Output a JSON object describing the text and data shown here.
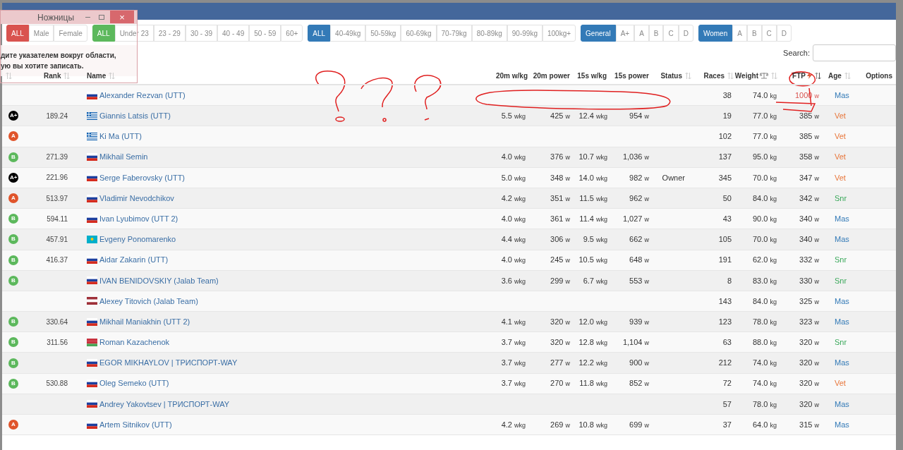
{
  "snip_window": {
    "title": "Ножницы",
    "close": "×",
    "message": [
      "дите указателем вокруг области,",
      "ую вы хотите записать."
    ]
  },
  "filter_groups": [
    {
      "color": "#d9534f",
      "options": [
        {
          "label": "ALL",
          "selected": true
        },
        {
          "label": "Male",
          "selected": false
        },
        {
          "label": "Female",
          "selected": false
        }
      ]
    },
    {
      "color": "#5cb85c",
      "options": [
        {
          "label": "ALL",
          "selected": true
        },
        {
          "label": "Under 23",
          "selected": false
        },
        {
          "label": "23 - 29",
          "selected": false
        },
        {
          "label": "30 - 39",
          "selected": false
        },
        {
          "label": "40 - 49",
          "selected": false
        },
        {
          "label": "50 - 59",
          "selected": false
        },
        {
          "label": "60+",
          "selected": false
        }
      ]
    },
    {
      "color": "#337ab7",
      "options": [
        {
          "label": "ALL",
          "selected": true
        },
        {
          "label": "40-49kg",
          "selected": false
        },
        {
          "label": "50-59kg",
          "selected": false
        },
        {
          "label": "60-69kg",
          "selected": false
        },
        {
          "label": "70-79kg",
          "selected": false
        },
        {
          "label": "80-89kg",
          "selected": false
        },
        {
          "label": "90-99kg",
          "selected": false
        },
        {
          "label": "100kg+",
          "selected": false
        }
      ]
    },
    {
      "color": "#337ab7",
      "options": [
        {
          "label": "General",
          "selected": true
        },
        {
          "label": "A+",
          "selected": false
        },
        {
          "label": "A",
          "selected": false
        },
        {
          "label": "B",
          "selected": false
        },
        {
          "label": "C",
          "selected": false
        },
        {
          "label": "D",
          "selected": false
        }
      ]
    },
    {
      "color": "#337ab7",
      "options": [
        {
          "label": "Women",
          "selected": true
        },
        {
          "label": "A",
          "selected": false
        },
        {
          "label": "B",
          "selected": false
        },
        {
          "label": "C",
          "selected": false
        },
        {
          "label": "D",
          "selected": false
        }
      ]
    }
  ],
  "search": {
    "label": "Search:"
  },
  "table": {
    "columns": [
      {
        "sortable": true,
        "sorted": false
      },
      {
        "label": "Rank",
        "sortable": true,
        "sorted": false
      },
      {
        "label": "Name",
        "sortable": true,
        "sorted": false
      },
      {
        "label": "20m w/kg",
        "sortable": false,
        "sorted": false
      },
      {
        "label": "20m power",
        "sortable": false,
        "sorted": false
      },
      {
        "label": "15s w/kg",
        "sortable": false,
        "sorted": false
      },
      {
        "label": "15s power",
        "sortable": false,
        "sorted": false
      },
      {
        "label": "Status",
        "sortable": true,
        "sorted": false
      },
      {
        "label": "Races",
        "sortable": true,
        "sorted": false
      },
      {
        "label": "Weight",
        "sortable": true,
        "sorted": false
      },
      {
        "label": "FTP",
        "sortable": true,
        "sorted": true
      },
      {
        "label": "Age",
        "sortable": true,
        "sorted": false
      },
      {
        "label": "Options",
        "sortable": false,
        "sorted": false
      }
    ],
    "rows": [
      {
        "rank": "",
        "kind": "ru",
        "name": "Alexander Rezvan (UTT)",
        "w20": "",
        "p20": "",
        "w15": "",
        "p15": "",
        "status": "",
        "races": "38",
        "weight": "74.0 kg",
        "ftp": "1000 w",
        "ftp_highlighted": true,
        "age": {
          "label": "Mas",
          "color": "#337ab7"
        }
      },
      {
        "badge": {
          "label": "A+",
          "color": "#000000"
        },
        "rank": "189.24",
        "kind": "gr",
        "name": "Giannis Latsis (UTT)",
        "w20": "5.5 wkg",
        "p20": "425 w",
        "w15": "12.4 wkg",
        "p15": "954 w",
        "status": "",
        "races": "19",
        "weight": "77.0 kg",
        "ftp": "385 w",
        "ftp_highlighted": false,
        "age": {
          "label": "Vet",
          "color": "#e8763a"
        }
      },
      {
        "badge": {
          "label": "A",
          "color": "#e0542b"
        },
        "rank": "",
        "kind": "gr",
        "name": "Ki Ma (UTT)",
        "w20": "",
        "p20": "",
        "w15": "",
        "p15": "",
        "status": "",
        "races": "102",
        "weight": "77.0 kg",
        "ftp": "385 w",
        "ftp_highlighted": false,
        "age": {
          "label": "Vet",
          "color": "#e8763a"
        }
      },
      {
        "badge": {
          "label": "B",
          "color": "#5cb85c"
        },
        "rank": "271.39",
        "kind": "ru",
        "name": "Mikhail Semin",
        "w20": "4.0 wkg",
        "p20": "376 w",
        "w15": "10.7 wkg",
        "p15": "1,036 w",
        "status": "",
        "races": "137",
        "weight": "95.0 kg",
        "ftp": "358 w",
        "ftp_highlighted": false,
        "age": {
          "label": "Vet",
          "color": "#e8763a"
        }
      },
      {
        "badge": {
          "label": "A+",
          "color": "#000000"
        },
        "rank": "221.96",
        "kind": "ru",
        "name": "Serge Faberovsky (UTT)",
        "w20": "5.0 wkg",
        "p20": "348 w",
        "w15": "14.0 wkg",
        "p15": "982 w",
        "status": "Owner",
        "races": "345",
        "weight": "70.0 kg",
        "ftp": "347 w",
        "ftp_highlighted": false,
        "age": {
          "label": "Vet",
          "color": "#e8763a"
        }
      },
      {
        "badge": {
          "label": "A",
          "color": "#e0542b"
        },
        "rank": "513.97",
        "kind": "ru",
        "name": "Vladimir Nevodchikov",
        "w20": "4.2 wkg",
        "p20": "351 w",
        "w15": "11.5 wkg",
        "p15": "962 w",
        "status": "",
        "races": "50",
        "weight": "84.0 kg",
        "ftp": "342 w",
        "ftp_highlighted": false,
        "age": {
          "label": "Snr",
          "color": "#3aa85a"
        }
      },
      {
        "badge": {
          "label": "B",
          "color": "#5cb85c"
        },
        "rank": "594.11",
        "kind": "ru",
        "name": "Ivan Lyubimov (UTT 2)",
        "w20": "4.0 wkg",
        "p20": "361 w",
        "w15": "11.4 wkg",
        "p15": "1,027 w",
        "status": "",
        "races": "43",
        "weight": "90.0 kg",
        "ftp": "340 w",
        "ftp_highlighted": false,
        "age": {
          "label": "Mas",
          "color": "#337ab7"
        }
      },
      {
        "badge": {
          "label": "B",
          "color": "#5cb85c"
        },
        "rank": "457.91",
        "kind": "kz",
        "name": "Evgeny Ponomarenko",
        "w20": "4.4 wkg",
        "p20": "306 w",
        "w15": "9.5 wkg",
        "p15": "662 w",
        "status": "",
        "races": "105",
        "weight": "70.0 kg",
        "ftp": "340 w",
        "ftp_highlighted": false,
        "age": {
          "label": "Mas",
          "color": "#337ab7"
        }
      },
      {
        "badge": {
          "label": "B",
          "color": "#5cb85c"
        },
        "rank": "416.37",
        "kind": "ru",
        "name": "Aidar Zakarin (UTT)",
        "w20": "4.0 wkg",
        "p20": "245 w",
        "w15": "10.5 wkg",
        "p15": "648 w",
        "status": "",
        "races": "191",
        "weight": "62.0 kg",
        "ftp": "332 w",
        "ftp_highlighted": false,
        "age": {
          "label": "Snr",
          "color": "#3aa85a"
        }
      },
      {
        "badge": {
          "label": "B",
          "color": "#5cb85c"
        },
        "rank": "",
        "kind": "ru",
        "name": "IVAN BENIDOVSKIY (Jalab Team)",
        "w20": "3.6 wkg",
        "p20": "299 w",
        "w15": "6.7 wkg",
        "p15": "553 w",
        "status": "",
        "races": "8",
        "weight": "83.0 kg",
        "ftp": "330 w",
        "ftp_highlighted": false,
        "age": {
          "label": "Snr",
          "color": "#3aa85a"
        }
      },
      {
        "rank": "",
        "kind": "lv",
        "name": "Alexey Titovich (Jalab Team)",
        "w20": "",
        "p20": "",
        "w15": "",
        "p15": "",
        "status": "",
        "races": "143",
        "weight": "84.0 kg",
        "ftp": "325 w",
        "ftp_highlighted": false,
        "age": {
          "label": "Mas",
          "color": "#337ab7"
        }
      },
      {
        "badge": {
          "label": "B",
          "color": "#5cb85c"
        },
        "rank": "330.64",
        "kind": "ru",
        "name": "Mikhail Maniakhin (UTT 2)",
        "w20": "4.1 wkg",
        "p20": "320 w",
        "w15": "12.0 wkg",
        "p15": "939 w",
        "status": "",
        "races": "123",
        "weight": "78.0 kg",
        "ftp": "323 w",
        "ftp_highlighted": false,
        "age": {
          "label": "Mas",
          "color": "#337ab7"
        }
      },
      {
        "badge": {
          "label": "B",
          "color": "#5cb85c"
        },
        "rank": "311.56",
        "kind": "by",
        "name": "Roman Kazachenok",
        "w20": "3.7 wkg",
        "p20": "320 w",
        "w15": "12.8 wkg",
        "p15": "1,104 w",
        "status": "",
        "races": "63",
        "weight": "88.0 kg",
        "ftp": "320 w",
        "ftp_highlighted": false,
        "age": {
          "label": "Snr",
          "color": "#3aa85a"
        }
      },
      {
        "badge": {
          "label": "B",
          "color": "#5cb85c"
        },
        "rank": "",
        "kind": "ru",
        "name": "EGOR MIKHAYLOV | ТРИСПОРТ-WAY",
        "w20": "3.7 wkg",
        "p20": "277 w",
        "w15": "12.2 wkg",
        "p15": "900 w",
        "status": "",
        "races": "212",
        "weight": "74.0 kg",
        "ftp": "320 w",
        "ftp_highlighted": false,
        "age": {
          "label": "Mas",
          "color": "#337ab7"
        }
      },
      {
        "badge": {
          "label": "B",
          "color": "#5cb85c"
        },
        "rank": "530.88",
        "kind": "ru",
        "name": "Oleg Semeko (UTT)",
        "w20": "3.7 wkg",
        "p20": "270 w",
        "w15": "11.8 wkg",
        "p15": "852 w",
        "status": "",
        "races": "72",
        "weight": "74.0 kg",
        "ftp": "320 w",
        "ftp_highlighted": false,
        "age": {
          "label": "Vet",
          "color": "#e8763a"
        }
      },
      {
        "rank": "",
        "kind": "ru",
        "name": "Andrey Yakovtsev | ТРИСПОРТ-WAY",
        "w20": "",
        "p20": "",
        "w15": "",
        "p15": "",
        "status": "",
        "races": "57",
        "weight": "78.0 kg",
        "ftp": "320 w",
        "ftp_highlighted": false,
        "age": {
          "label": "Mas",
          "color": "#337ab7"
        }
      },
      {
        "badge": {
          "label": "A",
          "color": "#e0542b"
        },
        "rank": "",
        "kind": "ru",
        "name": "Artem Sitnikov (UTT)",
        "w20": "4.2 wkg",
        "p20": "269 w",
        "w15": "10.8 wkg",
        "p15": "699 w",
        "status": "",
        "races": "37",
        "weight": "64.0 kg",
        "ftp": "315 w",
        "ftp_highlighted": false,
        "age": {
          "label": "Mas",
          "color": "#337ab7"
        }
      }
    ]
  }
}
